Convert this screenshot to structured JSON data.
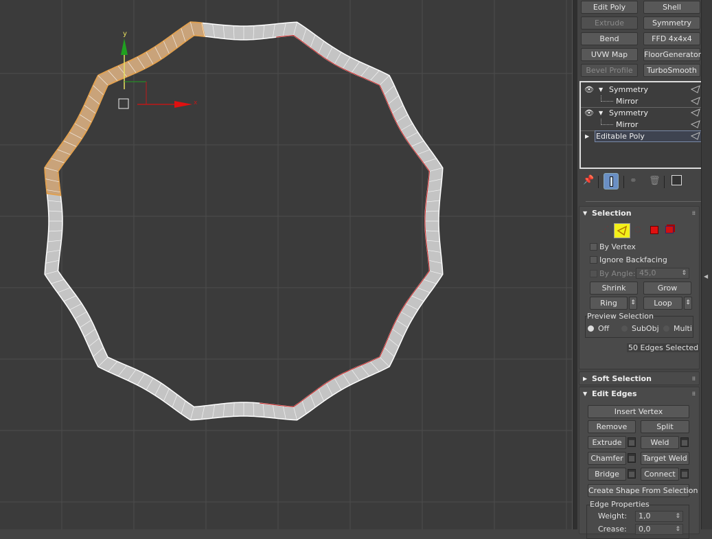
{
  "modifier_buttons": [
    {
      "label": "Edit Poly",
      "enabled": true
    },
    {
      "label": "Shell",
      "enabled": true
    },
    {
      "label": "Extrude",
      "enabled": false
    },
    {
      "label": "Symmetry",
      "enabled": true
    },
    {
      "label": "Bend",
      "enabled": true
    },
    {
      "label": "FFD 4x4x4",
      "enabled": true
    },
    {
      "label": "UVW Map",
      "enabled": true
    },
    {
      "label": "FloorGenerator",
      "enabled": true
    },
    {
      "label": "Bevel Profile",
      "enabled": false
    },
    {
      "label": "TurboSmooth",
      "enabled": true
    }
  ],
  "stack": {
    "items": [
      {
        "label": "Symmetry"
      },
      {
        "label": "Mirror"
      },
      {
        "label": "Symmetry"
      },
      {
        "label": "Mirror"
      },
      {
        "label": "Editable Poly"
      }
    ]
  },
  "viewport": {
    "axis_y": "y",
    "axis_x": "x",
    "colors": {
      "bg": "#3b3b3b",
      "grid": "#4c4c4c",
      "mesh": "#c4c4c4",
      "selected": "#e0a050",
      "edge_red": "#cc2020"
    }
  },
  "selection": {
    "title": "Selection",
    "by_vertex": "By Vertex",
    "ignore_backfacing": "Ignore Backfacing",
    "by_angle": "By Angle:",
    "angle_value": "45,0",
    "shrink": "Shrink",
    "grow": "Grow",
    "ring": "Ring",
    "loop": "Loop",
    "preview_title": "Preview Selection",
    "preview_off": "Off",
    "preview_subobj": "SubObj",
    "preview_multi": "Multi",
    "status": "50 Edges Selected"
  },
  "soft_selection": {
    "title": "Soft Selection"
  },
  "edit_edges": {
    "title": "Edit Edges",
    "insert_vertex": "Insert Vertex",
    "remove": "Remove",
    "split": "Split",
    "extrude": "Extrude",
    "weld": "Weld",
    "chamfer": "Chamfer",
    "target_weld": "Target Weld",
    "bridge": "Bridge",
    "connect": "Connect",
    "create_shape": "Create Shape From Selection",
    "edge_properties": "Edge Properties",
    "weight_label": "Weight:",
    "weight_value": "1,0",
    "crease_label": "Crease:",
    "crease_value": "0,0"
  }
}
